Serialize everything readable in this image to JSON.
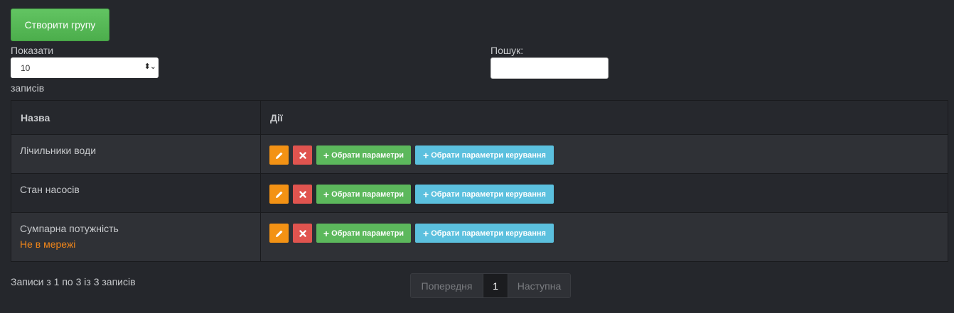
{
  "toolbar": {
    "create_label": "Створити групу"
  },
  "length": {
    "show_label": "Показати",
    "selected": "10",
    "records_label": "записів"
  },
  "search": {
    "label": "Пошук:",
    "value": ""
  },
  "table": {
    "headers": [
      "Назва",
      "Дії"
    ],
    "rows": [
      {
        "name": "Лічильники води",
        "status": ""
      },
      {
        "name": "Стан насосів",
        "status": ""
      },
      {
        "name": "Сумпарна потужність",
        "status": "Не в мережі"
      }
    ],
    "actions": {
      "params_label": "Обрати параметри",
      "control_label": "Обрати параметри керування"
    }
  },
  "footer": {
    "info": "Записи з 1 по 3 із 3 записів"
  },
  "pagination": {
    "prev": "Попередня",
    "current": "1",
    "next": "Наступна"
  },
  "icons": {
    "edit": "pencil-icon",
    "delete": "close-icon",
    "add": "plus-icon"
  },
  "colors": {
    "background": "#25272c",
    "create": "#5cb85c",
    "edit": "#f39214",
    "delete": "#e0544f",
    "params": "#5cb85c",
    "control": "#5bc0de",
    "offline": "#f0861a"
  }
}
